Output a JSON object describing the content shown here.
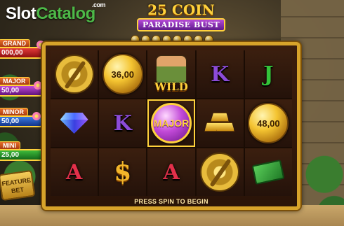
{
  "watermark": {
    "slot": "Slot",
    "catalog": "Catalog",
    "com": ".com"
  },
  "title": {
    "line1": "25 COIN",
    "line2": "PARADISE BUST"
  },
  "coin_meter_count": 8,
  "jackpots": [
    {
      "name": "GRAND",
      "value": "000,00",
      "color": "#e33a3a"
    },
    {
      "name": "MAJOR",
      "value": "50,00",
      "color": "#c24ad8"
    },
    {
      "name": "MINOR",
      "value": "50,00",
      "color": "#3a7be0"
    },
    {
      "name": "MINI",
      "value": "25,00",
      "color": "#3ebb3a"
    }
  ],
  "feature_bet": {
    "line1": "FEATURE",
    "line2": "BET"
  },
  "reels": {
    "columns": 5,
    "rows": 3,
    "symbols": [
      [
        "vault-icon",
        "coin-value",
        "wild",
        "letter-K",
        "letter-J"
      ],
      [
        "diamond-icon",
        "letter-K",
        "coin-major",
        "gold-bars-icon",
        "coin-value"
      ],
      [
        "letter-A",
        "dollar-icon",
        "letter-A",
        "vault-icon",
        "cash-icon"
      ]
    ],
    "coin_values": {
      "r1c2": "36,00",
      "r2c5": "48,00"
    },
    "wild_label": "WILD",
    "major_label": "MAJOR",
    "letters": {
      "K": "K",
      "J": "J",
      "A": "A"
    },
    "dollar": "$"
  },
  "status": {
    "message": "PRESS SPIN TO BEGIN"
  }
}
